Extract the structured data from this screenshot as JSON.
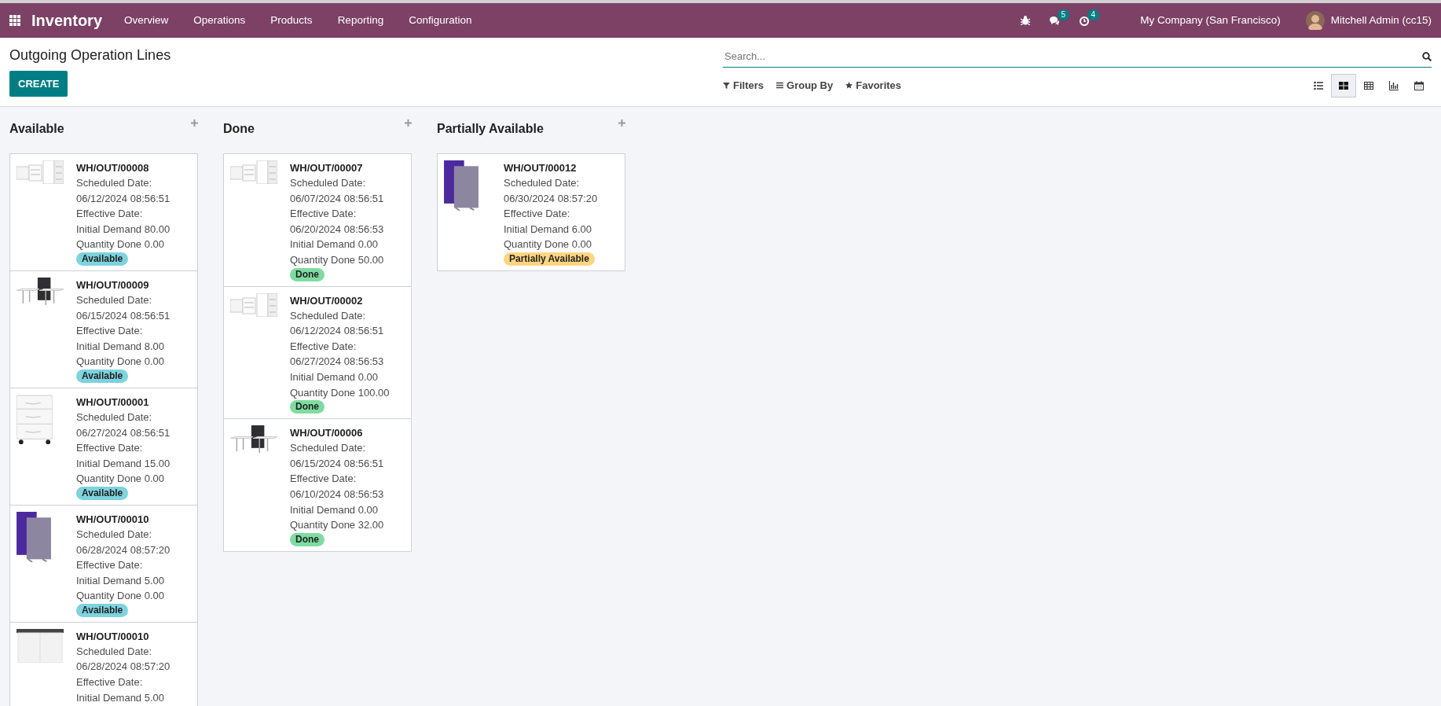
{
  "navbar": {
    "app_name": "Inventory",
    "menu": [
      "Overview",
      "Operations",
      "Products",
      "Reporting",
      "Configuration"
    ],
    "messages_count": "5",
    "activities_count": "4",
    "company": "My Company (San Francisco)",
    "user": "Mitchell Admin (cc15)"
  },
  "control_panel": {
    "title": "Outgoing Operation Lines",
    "create_button": "CREATE",
    "search": {
      "placeholder": "Search..."
    },
    "filters": [
      "Filters",
      "Group By",
      "Favorites"
    ],
    "views": [
      {
        "kind": "list",
        "selected": false
      },
      {
        "kind": "kanban",
        "selected": true
      },
      {
        "kind": "pivot",
        "selected": false
      },
      {
        "kind": "graph",
        "selected": false
      },
      {
        "kind": "calendar",
        "selected": false
      }
    ]
  },
  "columns": [
    {
      "title": "Available",
      "cards": [
        {
          "kind": "picture",
          "reference": "WH/OUT/00008",
          "lines": [
            "Scheduled Date:",
            "06/12/2024 08:56:51",
            "Effective Date:",
            "Initial Demand 80.00",
            "Quantity Done 0.00"
          ],
          "status": {
            "label": "Available",
            "color": "#7dd3de"
          }
        },
        {
          "kind": "picture",
          "reference": "WH/OUT/00009",
          "lines": [
            "Scheduled Date:",
            "06/15/2024 08:56:51",
            "Effective Date:",
            "Initial Demand 8.00",
            "Quantity Done 0.00"
          ],
          "status": {
            "label": "Available",
            "color": "#7dd3de"
          }
        },
        {
          "kind": "picture",
          "reference": "WH/OUT/00001",
          "lines": [
            "Scheduled Date:",
            "06/27/2024 08:56:51",
            "Effective Date:",
            "Initial Demand 15.00",
            "Quantity Done 0.00"
          ],
          "status": {
            "label": "Available",
            "color": "#7dd3de"
          }
        },
        {
          "kind": "picture",
          "reference": "WH/OUT/00010",
          "lines": [
            "Scheduled Date:",
            "06/28/2024 08:57:20",
            "Effective Date:",
            "Initial Demand 5.00",
            "Quantity Done 0.00"
          ],
          "status": {
            "label": "Available",
            "color": "#7dd3de"
          }
        },
        {
          "kind": "picture",
          "reference": "WH/OUT/00010",
          "lines": [
            "Scheduled Date:",
            "06/28/2024 08:57:20",
            "Effective Date:",
            "Initial Demand 5.00"
          ]
        }
      ]
    },
    {
      "title": "Done",
      "cards": [
        {
          "kind": "picture",
          "reference": "WH/OUT/00007",
          "lines": [
            "Scheduled Date:",
            "06/07/2024 08:56:51",
            "Effective Date:",
            "06/20/2024 08:56:53",
            "Initial Demand 0.00",
            "Quantity Done 50.00"
          ],
          "status": {
            "label": "Done",
            "color": "#7fdca0"
          }
        },
        {
          "kind": "picture",
          "reference": "WH/OUT/00002",
          "lines": [
            "Scheduled Date:",
            "06/12/2024 08:56:51",
            "Effective Date:",
            "06/27/2024 08:56:53",
            "Initial Demand 0.00",
            "Quantity Done 100.00"
          ],
          "status": {
            "label": "Done",
            "color": "#7fdca0"
          }
        },
        {
          "kind": "picture",
          "reference": "WH/OUT/00006",
          "lines": [
            "Scheduled Date:",
            "06/15/2024 08:56:51",
            "Effective Date:",
            "06/10/2024 08:56:53",
            "Initial Demand 0.00",
            "Quantity Done 32.00"
          ],
          "status": {
            "label": "Done",
            "color": "#7fdca0"
          }
        }
      ]
    },
    {
      "title": "Partially Available",
      "cards": [
        {
          "kind": "picture",
          "reference": "WH/OUT/00012",
          "lines": [
            "Scheduled Date:",
            "06/30/2024 08:57:20",
            "Effective Date:",
            "Initial Demand 6.00",
            "Quantity Done 0.00"
          ],
          "status": {
            "label": "Partially Available",
            "color": "#ffd580"
          }
        }
      ]
    }
  ]
}
